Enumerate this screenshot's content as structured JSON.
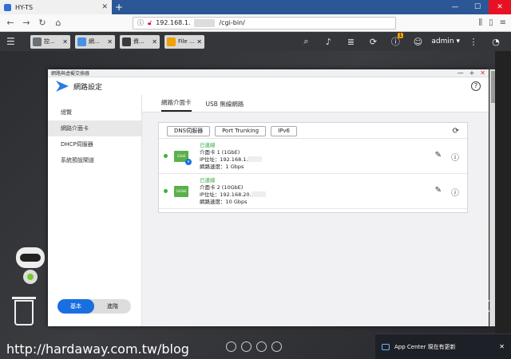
{
  "browser": {
    "tab_title": "HY-TS",
    "url_prefix": "192.168.1.",
    "url_suffix": "/cgi-bin/"
  },
  "qts": {
    "apps": [
      {
        "label": "控...",
        "icon_color": "#6b6f76",
        "icon": "control-panel-icon"
      },
      {
        "label": "網...",
        "icon_color": "#4a90e2",
        "icon": "network-icon"
      },
      {
        "label": "資...",
        "icon_color": "#3a3a3a",
        "icon": "resource-monitor-icon"
      },
      {
        "label": "File ...",
        "icon_color": "#f0a000",
        "icon": "file-station-icon"
      }
    ],
    "notification_badge": "1",
    "username": "admin ▾"
  },
  "window": {
    "title": "網路與虛擬交換器",
    "app_name": "網路設定",
    "sidebar": [
      "總覽",
      "網路介面卡",
      "DHCP伺服器",
      "系統預設閘道"
    ],
    "mode_basic": "基本",
    "mode_advanced": "進階",
    "tabs": [
      "網路介面卡",
      "USB 無線網路"
    ],
    "buttons": [
      "DNS伺服器",
      "Port Trunking",
      "IPv6"
    ],
    "adapters": [
      {
        "badge": "1GbE",
        "status": "已連線",
        "name": "介面卡 1 (1GbE)",
        "ip_label": "IP位址：192.168.1.",
        "speed": "網路速度：1 Gbps",
        "sub_badge": "v"
      },
      {
        "badge": "10GbE",
        "status": "已連線",
        "name": "介面卡 2 (10GbE)",
        "ip_label": "IP位址：192.168.20.",
        "speed": "網路速度：10 Gbps",
        "sub_badge": ""
      }
    ]
  },
  "desktop": {
    "clock_fragment": "3",
    "toast": "App Center 現在有更新",
    "watermark": "http://hardaway.com.tw/blog"
  }
}
